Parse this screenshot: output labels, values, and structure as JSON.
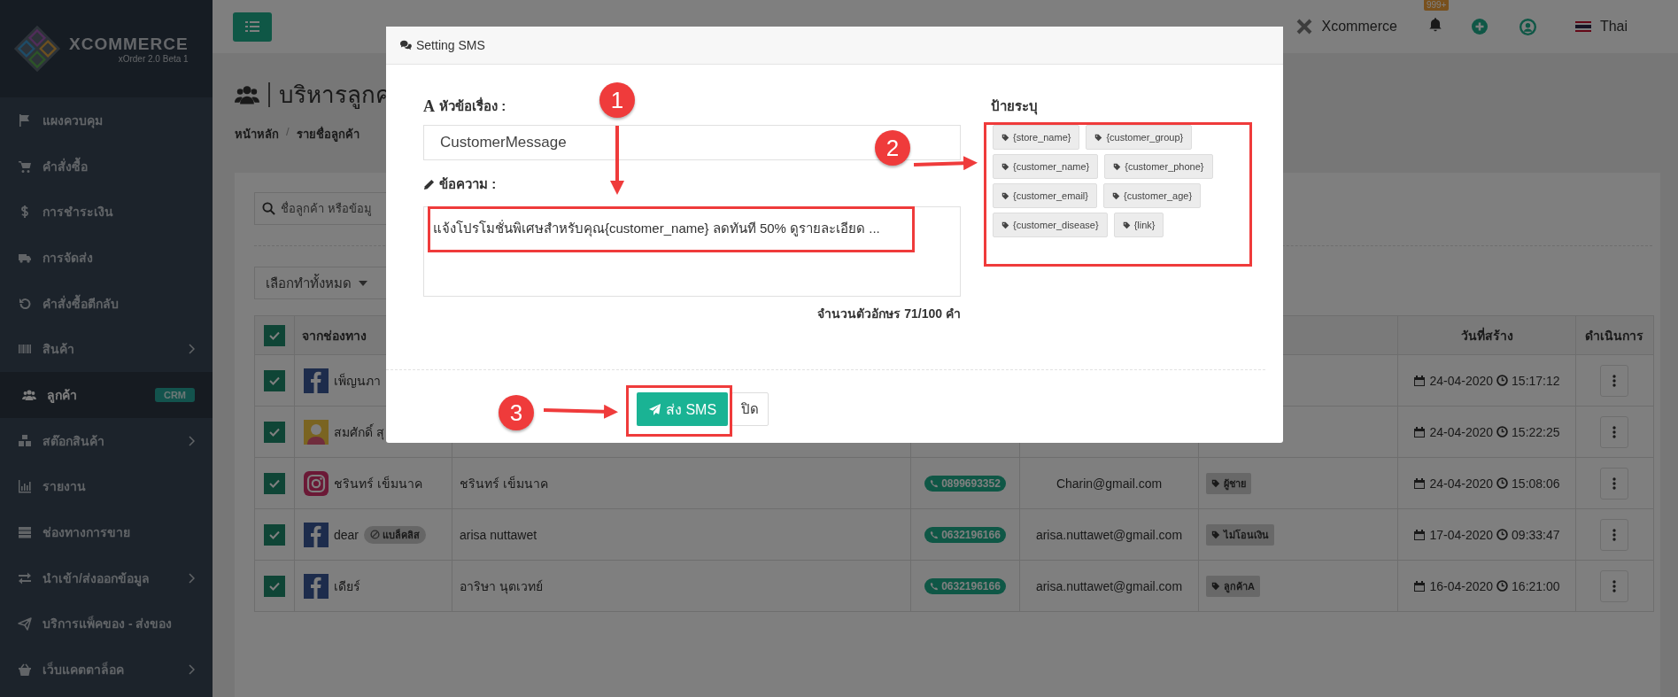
{
  "sidebar": {
    "brand": "XCOMMERCE",
    "version": "xOrder 2.0 Beta 1",
    "items": [
      {
        "label": "แผงควบคุม",
        "selected": false,
        "has_submenu": false
      },
      {
        "label": "คำสั่งซื้อ",
        "selected": false,
        "has_submenu": false
      },
      {
        "label": "การชำระเงิน",
        "selected": false,
        "has_submenu": false
      },
      {
        "label": "การจัดส่ง",
        "selected": false,
        "has_submenu": false
      },
      {
        "label": "คำสั่งซื้อตีกลับ",
        "selected": false,
        "has_submenu": false
      },
      {
        "label": "สินค้า",
        "selected": false,
        "has_submenu": true
      },
      {
        "label": "ลูกค้า",
        "selected": true,
        "has_submenu": false,
        "badge": "CRM"
      },
      {
        "label": "สต๊อกสินค้า",
        "selected": false,
        "has_submenu": true
      },
      {
        "label": "รายงาน",
        "selected": false,
        "has_submenu": false
      },
      {
        "label": "ช่องทางการขาย",
        "selected": false,
        "has_submenu": false
      },
      {
        "label": "นำเข้า/ส่งออกข้อมูล",
        "selected": false,
        "has_submenu": true
      },
      {
        "label": "บริการแพ็คของ - ส่งของ",
        "selected": false,
        "has_submenu": false
      },
      {
        "label": "เว็บแคตตาล็อค",
        "selected": false,
        "has_submenu": true
      }
    ]
  },
  "topbar": {
    "account": "Xcommerce",
    "notification_count": "999+",
    "language": "Thai"
  },
  "page": {
    "title": "บริหารลูกค",
    "breadcrumb": [
      "หน้าหลัก",
      "รายชื่อลูกค้า"
    ],
    "breadcrumb_separator": "/"
  },
  "search": {
    "placeholder": "ชื่อลูกค้า หรือข้อมู"
  },
  "bulk_action": "เลือกทำทั้งหมด",
  "table": {
    "header_checked": true,
    "columns": [
      "จากช่องทาง",
      "วันที่สร้าง",
      "ดำเนินการ"
    ],
    "rows": [
      {
        "checked": true,
        "kind": "facebook",
        "name": "เพ็ญนภา",
        "date": "24-04-2020",
        "time": "15:17:12"
      },
      {
        "checked": true,
        "kind": "avatar",
        "name": "สมศักดิ์ สุ",
        "date": "24-04-2020",
        "time": "15:22:25"
      },
      {
        "checked": true,
        "kind": "instagram",
        "name": "ชรินทร์ เข็มนาค",
        "full_name": "ชรินทร์ เข็มนาค",
        "phone": "0899693352",
        "email": "Charin@gmail.com",
        "tag": "ผู้ชาย",
        "date": "24-04-2020",
        "time": "15:08:06"
      },
      {
        "checked": true,
        "kind": "facebook",
        "name": "dear",
        "blacklist": "แบล็คลิส",
        "full_name": "arisa nuttawet",
        "phone": "0632196166",
        "email": "arisa.nuttawet@gmail.com",
        "tag": "ไม่โอนเงิน",
        "date": "17-04-2020",
        "time": "09:33:47"
      },
      {
        "checked": true,
        "kind": "facebook",
        "name": "เดียร์",
        "full_name": "อาริษา นุตเวทย์",
        "phone": "0632196166",
        "email": "arisa.nuttawet@gmail.com",
        "tag": "ลูกค้าA",
        "date": "16-04-2020",
        "time": "16:21:00"
      }
    ]
  },
  "modal": {
    "title": "Setting SMS",
    "subject_icon_glyph": "A",
    "subject_label": "หัวข้อเรื่อง :",
    "subject_value": "CustomerMessage",
    "message_label": "ข้อความ :",
    "message_value": "แจ้งโปรโมชั่นพิเศษสำหรับคุณ{customer_name} ลดทันที 50% ดูรายละเอียด ...",
    "counter": "จำนวนตัวอักษร 71/100 คำ",
    "tags_label": "ป้ายระบุ",
    "tags": [
      "{store_name}",
      "{customer_group}",
      "{customer_name}",
      "{customer_phone}",
      "{customer_email}",
      "{customer_age}",
      "{customer_disease}",
      "{link}"
    ],
    "send_button": "ส่ง SMS",
    "close_button": "ปิด"
  },
  "annotations": [
    {
      "number": "1"
    },
    {
      "number": "2"
    },
    {
      "number": "3"
    }
  ]
}
